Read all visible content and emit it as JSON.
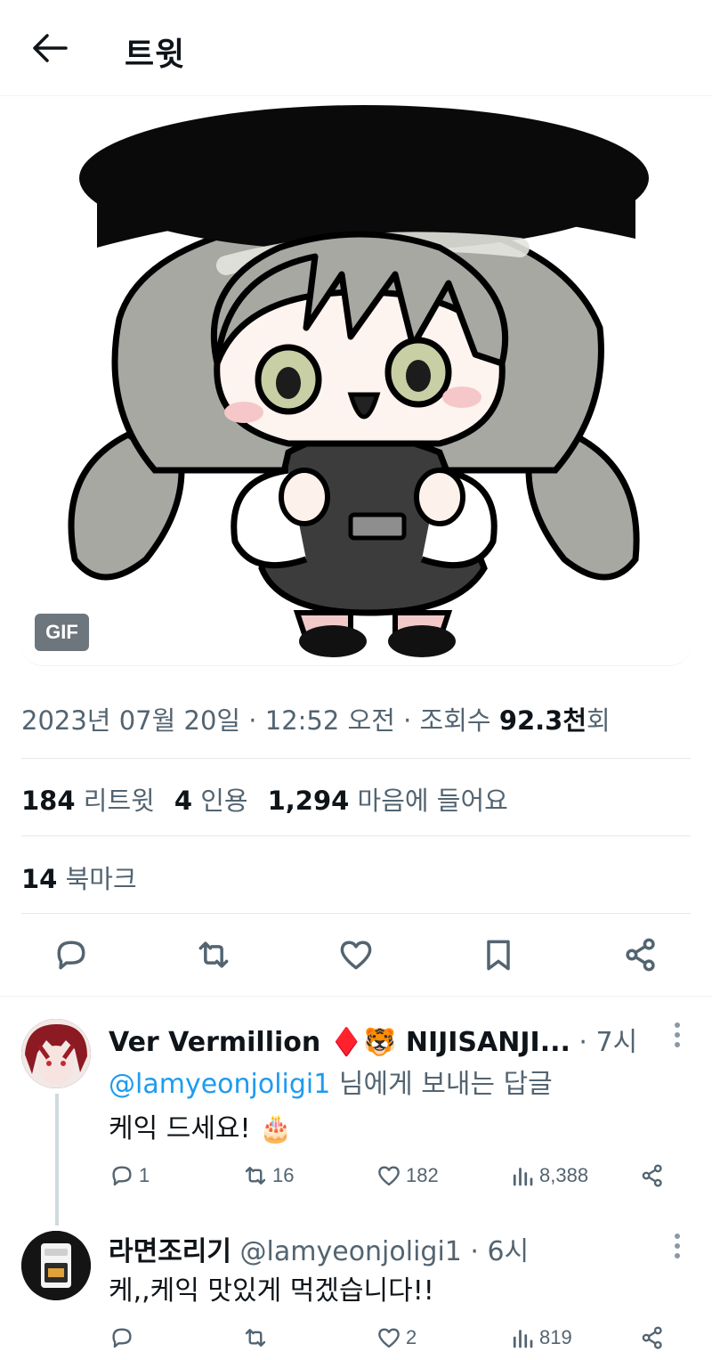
{
  "header": {
    "title": "트윗"
  },
  "media": {
    "badge": "GIF"
  },
  "meta": {
    "date": "2023년 07월 20일 · 12:52 오전 · 조회수 ",
    "views_num": "92.3천",
    "views_unit": "회"
  },
  "stats": {
    "retweets_num": "184",
    "retweets_label": "리트윗",
    "quotes_num": "4",
    "quotes_label": "인용",
    "likes_num": "1,294",
    "likes_label": "마음에 들어요",
    "bookmarks_num": "14",
    "bookmarks_label": "북마크"
  },
  "actions": [
    "reply-icon",
    "retweet-icon",
    "heart-icon",
    "bookmark-icon",
    "share-icon"
  ],
  "replies": [
    {
      "name": "Ver Vermillion ♦️🐯 NIJISANJI...",
      "time": " · 7시",
      "reply_to_handle": "@lamyeonjoligi1",
      "reply_to_suffix": " 님에게 보내는 답글",
      "text": "케익 드세요! 🎂",
      "reply_count": "1",
      "retweet_count": "16",
      "like_count": "182",
      "view_count": "8,388"
    },
    {
      "name": "라면조리기",
      "handle_time": " @lamyeonjoligi1 · 6시",
      "text": "케,,케익 맛있게 먹겠습니다!!",
      "reply_count": "",
      "retweet_count": "",
      "like_count": "2",
      "view_count": "819"
    }
  ],
  "colors": {
    "link": "#1d9bf0",
    "muted": "#536471",
    "text": "#0f1419"
  }
}
